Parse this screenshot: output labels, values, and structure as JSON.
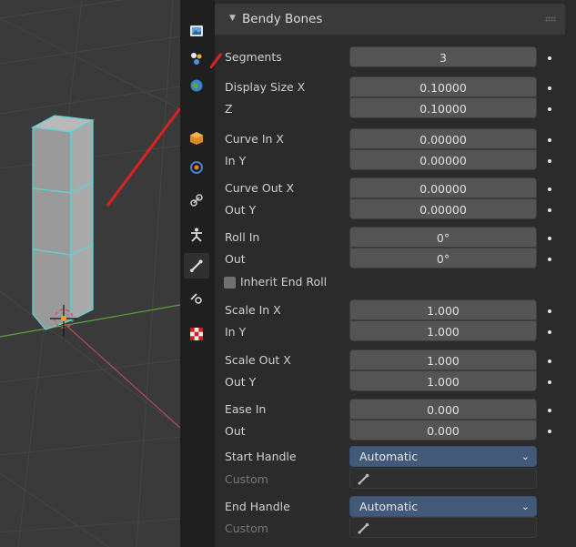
{
  "panel": {
    "title": "Bendy Bones",
    "rows": {
      "segments": {
        "label": "Segments",
        "value": "3"
      },
      "display_size_x": {
        "label": "Display Size X",
        "value": "0.10000"
      },
      "z": {
        "label": "Z",
        "value": "0.10000"
      },
      "curve_in_x": {
        "label": "Curve In X",
        "value": "0.00000"
      },
      "curve_in_y": {
        "label": "In Y",
        "value": "0.00000"
      },
      "curve_out_x": {
        "label": "Curve Out X",
        "value": "0.00000"
      },
      "curve_out_y": {
        "label": "Out Y",
        "value": "0.00000"
      },
      "roll_in": {
        "label": "Roll In",
        "value": "0°"
      },
      "roll_out": {
        "label": "Out",
        "value": "0°"
      },
      "inherit_end_roll": {
        "label": "Inherit End Roll",
        "checked": false
      },
      "scale_in_x": {
        "label": "Scale In X",
        "value": "1.000"
      },
      "scale_in_y": {
        "label": "In Y",
        "value": "1.000"
      },
      "scale_out_x": {
        "label": "Scale Out X",
        "value": "1.000"
      },
      "scale_out_y": {
        "label": "Out Y",
        "value": "1.000"
      },
      "ease_in": {
        "label": "Ease In",
        "value": "0.000"
      },
      "ease_out": {
        "label": "Out",
        "value": "0.000"
      },
      "start_handle": {
        "label": "Start Handle",
        "value": "Automatic"
      },
      "start_custom": {
        "label": "Custom"
      },
      "end_handle": {
        "label": "End Handle",
        "value": "Automatic"
      },
      "end_custom": {
        "label": "Custom"
      }
    }
  },
  "tabs": [
    "render-tab",
    "scene-tab",
    "world-tab",
    "object-tab",
    "physics-tab",
    "constraints-tab",
    "object-data-tab",
    "bone-tab",
    "bone-constraints-tab",
    "texture-tab"
  ],
  "colors": {
    "accent": "#43597a",
    "arrow": "#e02020",
    "selection": "#5fd0d8"
  }
}
